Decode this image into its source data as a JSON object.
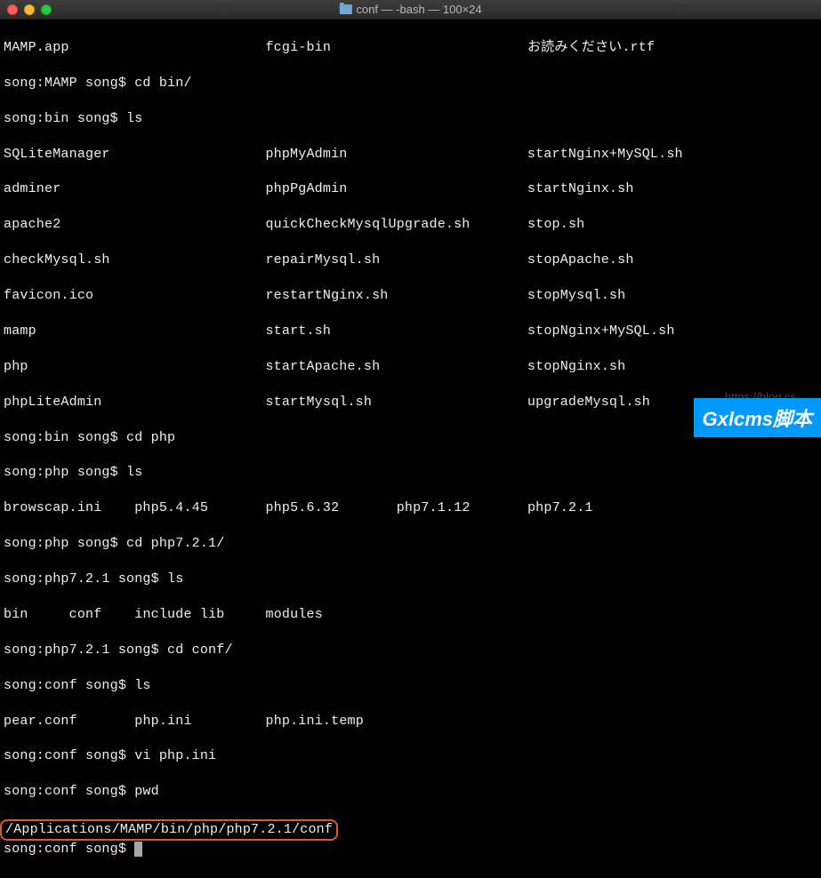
{
  "window": {
    "title": "conf — -bash — 100×24"
  },
  "cols": {
    "mamp_row": {
      "c1": "MAMP.app",
      "c2": "fcgi-bin",
      "c3": "お読みください.rtf"
    },
    "bin_rows": [
      {
        "c1": "SQLiteManager",
        "c2": "phpMyAdmin",
        "c3": "startNginx+MySQL.sh"
      },
      {
        "c1": "adminer",
        "c2": "phpPgAdmin",
        "c3": "startNginx.sh"
      },
      {
        "c1": "apache2",
        "c2": "quickCheckMysqlUpgrade.sh",
        "c3": "stop.sh"
      },
      {
        "c1": "checkMysql.sh",
        "c2": "repairMysql.sh",
        "c3": "stopApache.sh"
      },
      {
        "c1": "favicon.ico",
        "c2": "restartNginx.sh",
        "c3": "stopMysql.sh"
      },
      {
        "c1": "mamp",
        "c2": "start.sh",
        "c3": "stopNginx+MySQL.sh"
      },
      {
        "c1": "php",
        "c2": "startApache.sh",
        "c3": "stopNginx.sh"
      },
      {
        "c1": "phpLiteAdmin",
        "c2": "startMysql.sh",
        "c3": "upgradeMysql.sh"
      }
    ],
    "php_versions": {
      "c1": "browscap.ini",
      "c2": "php5.4.45",
      "c3": "php5.6.32",
      "c4": "php7.1.12",
      "c5": "php7.2.1"
    },
    "php721": {
      "c1": "bin",
      "c2": "conf",
      "c3": "include",
      "c4": "lib",
      "c5": "modules"
    },
    "conf_ls": {
      "c1": "pear.conf",
      "c2": "php.ini",
      "c3": "php.ini.temp"
    }
  },
  "prompts": {
    "p1": "song:MAMP song$ cd bin/",
    "p2": "song:bin song$ ls",
    "p3": "song:bin song$ cd php",
    "p4": "song:php song$ ls",
    "p5": "song:php song$ cd php7.2.1/",
    "p6": "song:php7.2.1 song$ ls",
    "p7": "song:php7.2.1 song$ cd conf/",
    "p8": "song:conf song$ ls",
    "p9": "song:conf song$ vi php.ini",
    "p10": "song:conf song$ pwd",
    "p11": "song:conf song$ "
  },
  "pwd_output": "/Applications/MAMP/bin/php/php7.2.1/conf",
  "watermark": {
    "url": "https://blog.cs",
    "logo": "Gxlcms脚本"
  }
}
